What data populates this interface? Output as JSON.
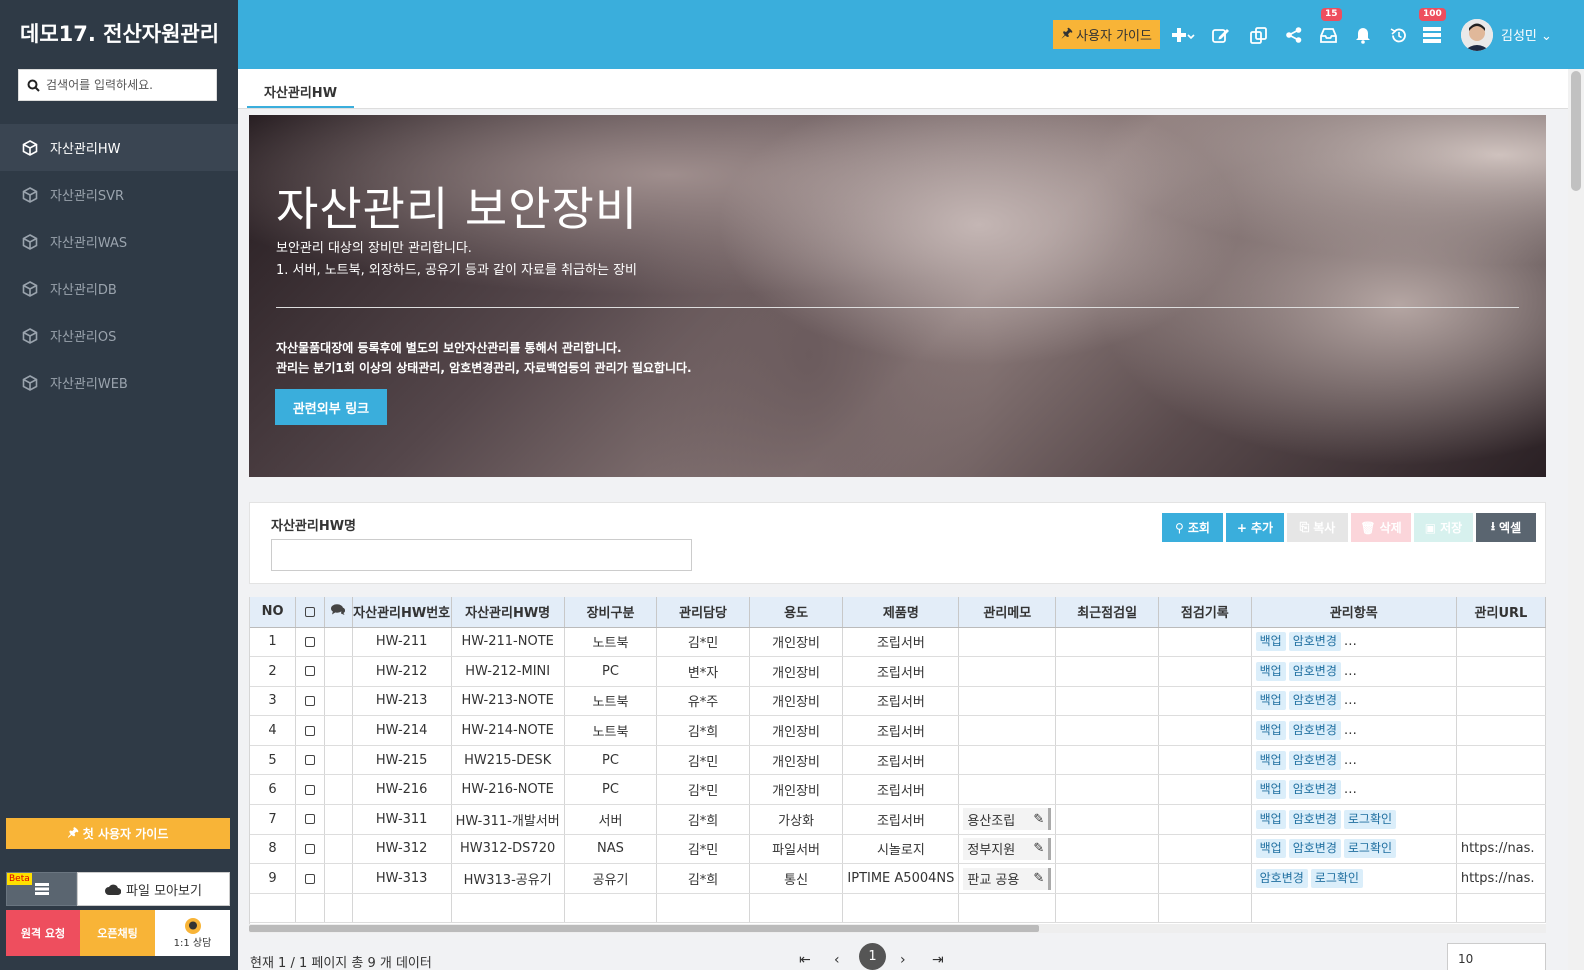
{
  "sidebar": {
    "title": "데모17. 전산자원관리",
    "search_placeholder": "검색어를 입력하세요.",
    "items": [
      {
        "label": "자산관리HW",
        "active": true
      },
      {
        "label": "자산관리SVR"
      },
      {
        "label": "자산관리WAS"
      },
      {
        "label": "자산관리DB"
      },
      {
        "label": "자산관리OS"
      },
      {
        "label": "자산관리WEB"
      }
    ],
    "first_guide_label": "첫 사용자 가이드",
    "beta_label": "Beta",
    "files_label": "파일 모아보기",
    "remote_label": "원격 요청",
    "openchat_label": "오픈채팅",
    "consult_label": "1:1 상담"
  },
  "header": {
    "guide_label": "사용자 가이드",
    "inbox_badge": "15",
    "list_badge": "100",
    "user_name": "김성민"
  },
  "tabs": [
    {
      "label": "자산관리HW"
    }
  ],
  "banner": {
    "title": "자산관리 보안장비",
    "desc1": "보안관리 대상의 장비만 관리합니다.",
    "desc2": "1. 서버, 노트북, 외장하드, 공유기 등과 같이 자료를 취급하는 장비",
    "note1": "자산물품대장에 등록후에 별도의 보안자산관리를 통해서 관리합니다.",
    "note2": "관리는 분기1회 이상의 상태관리, 암호변경관리, 자료백업등의 관리가 필요합니다.",
    "link_label": "관련외부 링크"
  },
  "search": {
    "label": "자산관리HW명",
    "value": "",
    "buttons": {
      "search": "조회",
      "add": "추가",
      "copy": "복사",
      "delete": "삭제",
      "save": "저장",
      "excel": "엑셀"
    }
  },
  "grid": {
    "columns": [
      "NO",
      "",
      "",
      "자산관리HW번호",
      "자산관리HW명",
      "장비구분",
      "관리담당",
      "용도",
      "제품명",
      "관리메모",
      "최근점검일",
      "점검기록",
      "관리항목",
      "관리URL"
    ],
    "rows": [
      {
        "no": "1",
        "id": "HW-211",
        "name": "HW-211-NOTE",
        "type": "노트북",
        "owner": "김*민",
        "use": "개인장비",
        "product": "조립서버",
        "memo": "",
        "last": "",
        "log": "",
        "items": [
          "백업",
          "암호변경",
          "…"
        ],
        "url": ""
      },
      {
        "no": "2",
        "id": "HW-212",
        "name": "HW-212-MINI",
        "type": "PC",
        "owner": "변*자",
        "use": "개인장비",
        "product": "조립서버",
        "memo": "",
        "last": "",
        "log": "",
        "items": [
          "백업",
          "암호변경",
          "…"
        ],
        "url": ""
      },
      {
        "no": "3",
        "id": "HW-213",
        "name": "HW-213-NOTE",
        "type": "노트북",
        "owner": "유*주",
        "use": "개인장비",
        "product": "조립서버",
        "memo": "",
        "last": "",
        "log": "",
        "items": [
          "백업",
          "암호변경",
          "…"
        ],
        "url": ""
      },
      {
        "no": "4",
        "id": "HW-214",
        "name": "HW-214-NOTE",
        "type": "노트북",
        "owner": "김*희",
        "use": "개인장비",
        "product": "조립서버",
        "memo": "",
        "last": "",
        "log": "",
        "items": [
          "백업",
          "암호변경",
          "…"
        ],
        "url": ""
      },
      {
        "no": "5",
        "id": "HW-215",
        "name": "HW215-DESK",
        "type": "PC",
        "owner": "김*민",
        "use": "개인장비",
        "product": "조립서버",
        "memo": "",
        "last": "",
        "log": "",
        "items": [
          "백업",
          "암호변경",
          "…"
        ],
        "url": ""
      },
      {
        "no": "6",
        "id": "HW-216",
        "name": "HW-216-NOTE",
        "type": "PC",
        "owner": "김*민",
        "use": "개인장비",
        "product": "조립서버",
        "memo": "",
        "last": "",
        "log": "",
        "items": [
          "백업",
          "암호변경",
          "…"
        ],
        "url": ""
      },
      {
        "no": "7",
        "id": "HW-311",
        "name": "HW-311-개발서버",
        "type": "서버",
        "owner": "김*희",
        "use": "가상화",
        "product": "조립서버",
        "memo": "용산조립",
        "last": "",
        "log": "",
        "items": [
          "백업",
          "암호변경",
          "로그확인"
        ],
        "url": ""
      },
      {
        "no": "8",
        "id": "HW-312",
        "name": "HW312-DS720",
        "type": "NAS",
        "owner": "김*민",
        "use": "파일서버",
        "product": "시놀로지",
        "memo": "정부지원",
        "last": "",
        "log": "",
        "items": [
          "백업",
          "암호변경",
          "로그확인"
        ],
        "url": "https://nas."
      },
      {
        "no": "9",
        "id": "HW-313",
        "name": "HW313-공유기",
        "type": "공유기",
        "owner": "김*희",
        "use": "통신",
        "product": "IPTIME A5004NS",
        "memo": "판교 공용",
        "last": "",
        "log": "",
        "items": [
          "암호변경",
          "로그확인"
        ],
        "url": "https://nas."
      }
    ]
  },
  "footer": {
    "status": "현재 1 / 1 페이지 총 9 개 데이터",
    "page": "1",
    "page_size": "10"
  },
  "colors": {
    "header": "#3aaedc",
    "sidebar": "#2f3a46",
    "accent": "#f8b437",
    "danger": "#ee4e5e"
  }
}
